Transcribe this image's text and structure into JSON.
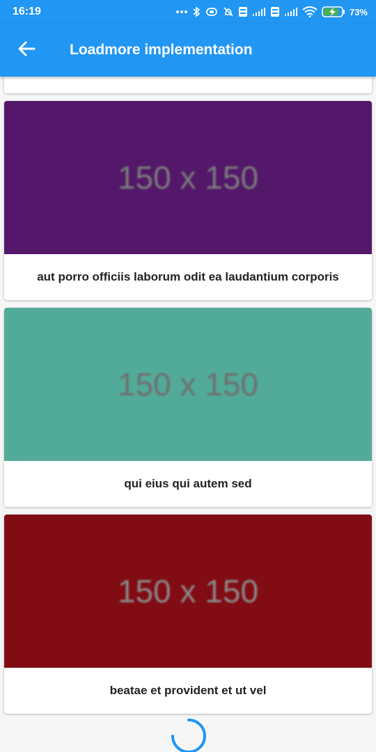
{
  "status_bar": {
    "time": "16:19",
    "battery": "73%",
    "icons": [
      "more-dots-icon",
      "bluetooth-icon",
      "vibrate-icon",
      "alarm-off-icon",
      "volte-icon",
      "signal-icon",
      "volte-icon",
      "signal-icon",
      "wifi-icon",
      "battery-charging-icon"
    ]
  },
  "app_bar": {
    "title": "Loadmore implementation",
    "back_icon": "arrow-back-icon",
    "background": "#2196f3"
  },
  "items": [
    {
      "image_label": "150 x 150",
      "image_color": "#54186a",
      "image_text_color": "#7b7b7b",
      "title": "aut porro officiis laborum odit ea laudantium corporis"
    },
    {
      "image_label": "150 x 150",
      "image_color": "#52ab98",
      "image_text_color": "#6f6f6f",
      "title": "qui eius qui autem sed"
    },
    {
      "image_label": "150 x 150",
      "image_color": "#820c14",
      "image_text_color": "#8a8a8a",
      "title": "beatae et provident et ut vel"
    }
  ],
  "loading_indicator": {
    "icon": "loading-spinner-icon",
    "color": "#2196f3"
  }
}
